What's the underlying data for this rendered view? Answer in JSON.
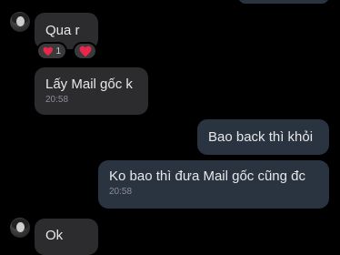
{
  "messages": [
    {
      "text": "Qua r"
    },
    {
      "text": "Lấy Mail gốc k",
      "time": "20:58"
    },
    {
      "text": "Bao back thì khỏi"
    },
    {
      "text": "Ko bao thì đưa Mail gốc cũng đc",
      "time": "20:58"
    },
    {
      "text": "Ok"
    }
  ],
  "reactions": [
    {
      "icon": "heart-icon",
      "count": "1"
    },
    {
      "icon": "heart-icon"
    }
  ],
  "colors": {
    "background": "#000000",
    "incoming_bubble": "#2c2c2e",
    "outgoing_bubble": "#2a3340",
    "heart": "#e8274b"
  }
}
